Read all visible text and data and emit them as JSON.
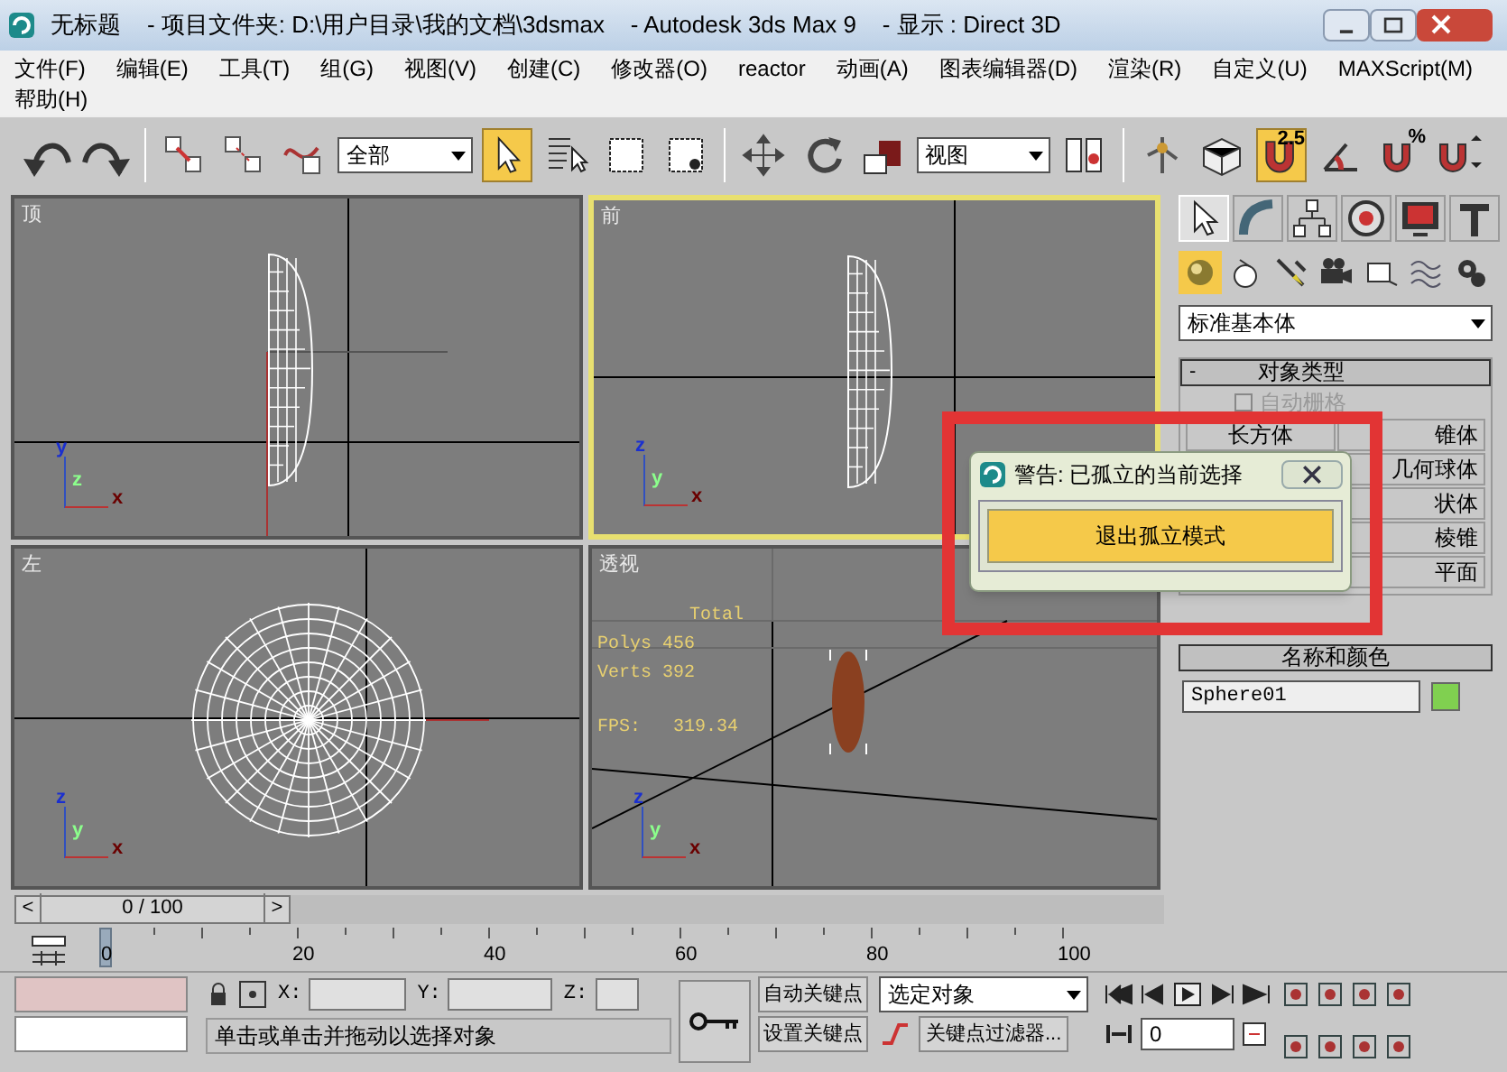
{
  "window": {
    "title": "无标题    - 项目文件夹: D:\\用户目录\\我的文档\\3dsmax    - Autodesk 3ds Max 9    - 显示 : Direct 3D"
  },
  "menu": [
    "文件(F)",
    "编辑(E)",
    "工具(T)",
    "组(G)",
    "视图(V)",
    "创建(C)",
    "修改器(O)",
    "reactor",
    "动画(A)",
    "图表编辑器(D)",
    "渲染(R)",
    "自定义(U)",
    "MAXScript(M)",
    "帮助(H)"
  ],
  "toolbar": [
    {
      "kind": "undo",
      "selected": false
    },
    {
      "kind": "redo",
      "selected": false
    },
    {
      "kind": "sep"
    },
    {
      "kind": "link",
      "selected": false
    },
    {
      "kind": "unlink",
      "selected": false
    },
    {
      "kind": "bind",
      "selected": false
    },
    {
      "kind": "dropdown",
      "value": "全部"
    },
    {
      "kind": "select",
      "selected": true
    },
    {
      "kind": "select-list",
      "selected": false
    },
    {
      "kind": "rect-region",
      "selected": false
    },
    {
      "kind": "window",
      "selected": false
    },
    {
      "kind": "sep"
    },
    {
      "kind": "move",
      "selected": false
    },
    {
      "kind": "rotate",
      "selected": false
    },
    {
      "kind": "scale",
      "selected": false
    },
    {
      "kind": "dropdown",
      "value": "视图"
    },
    {
      "kind": "pivot",
      "selected": false
    },
    {
      "kind": "sep"
    },
    {
      "kind": "manipulate",
      "selected": false
    },
    {
      "kind": "keyboard",
      "selected": false
    },
    {
      "kind": "snap",
      "label": "2.5",
      "selected": true
    },
    {
      "kind": "angle-snap",
      "selected": false
    },
    {
      "kind": "percent-snap",
      "label": "%",
      "selected": false
    },
    {
      "kind": "spinner-snap",
      "selected": false
    }
  ],
  "viewports": [
    {
      "label": "顶",
      "kind": "top",
      "selected": false,
      "axes": [
        "y",
        "z",
        "x"
      ]
    },
    {
      "label": "前",
      "kind": "front",
      "selected": true,
      "axes": [
        "z",
        "y",
        "x"
      ]
    },
    {
      "label": "左",
      "kind": "left",
      "selected": false,
      "axes": [
        "z",
        "y",
        "x"
      ]
    },
    {
      "label": "透视",
      "kind": "perspective",
      "selected": false,
      "axes": [
        "z",
        "y",
        "x"
      ],
      "stats": [
        "Total",
        "Polys 456",
        "Verts 392",
        "FPS:   319.34"
      ]
    }
  ],
  "command_panel": {
    "tabs": [
      {
        "kind": "create",
        "selected": true
      },
      {
        "kind": "modify",
        "selected": false
      },
      {
        "kind": "hierarchy",
        "selected": false
      },
      {
        "kind": "motion",
        "selected": false
      },
      {
        "kind": "display",
        "selected": false
      },
      {
        "kind": "utilities",
        "selected": false
      }
    ],
    "categories": [
      {
        "kind": "geometry",
        "selected": true
      },
      {
        "kind": "shapes",
        "selected": false
      },
      {
        "kind": "lights",
        "selected": false
      },
      {
        "kind": "cameras",
        "selected": false
      },
      {
        "kind": "helpers",
        "selected": false
      },
      {
        "kind": "spacewarps",
        "selected": false
      },
      {
        "kind": "systems",
        "selected": false
      }
    ],
    "type_dropdown": "标准基本体",
    "object_type": {
      "collapse": "-",
      "title": "对象类型",
      "autogrid": {
        "label": "自动栅格",
        "checked": false
      },
      "buttons": [
        "长方体",
        "锥体",
        "几何球体",
        "状体",
        "棱锥",
        "平面"
      ]
    },
    "name_color": {
      "title": "名称和颜色",
      "name": "Sphere01",
      "color": "#80d050"
    }
  },
  "dialog": {
    "title": "警告: 已孤立的当前选择",
    "button": "退出孤立模式"
  },
  "time_slider": {
    "label": "0 / 100",
    "prev": "<",
    "next": ">",
    "level": 0
  },
  "track": {
    "ticks": [
      "0",
      "20",
      "40",
      "60",
      "80",
      "100"
    ]
  },
  "status": {
    "x_label": "X:",
    "y_label": "Y:",
    "z_label": "Z:",
    "prompt": "单击或单击并拖动以选择对象",
    "auto_key": "自动关键点",
    "set_key": "设置关键点",
    "key_mode": "选定对象",
    "key_filters": "关键点过滤器...",
    "frame": "0"
  }
}
